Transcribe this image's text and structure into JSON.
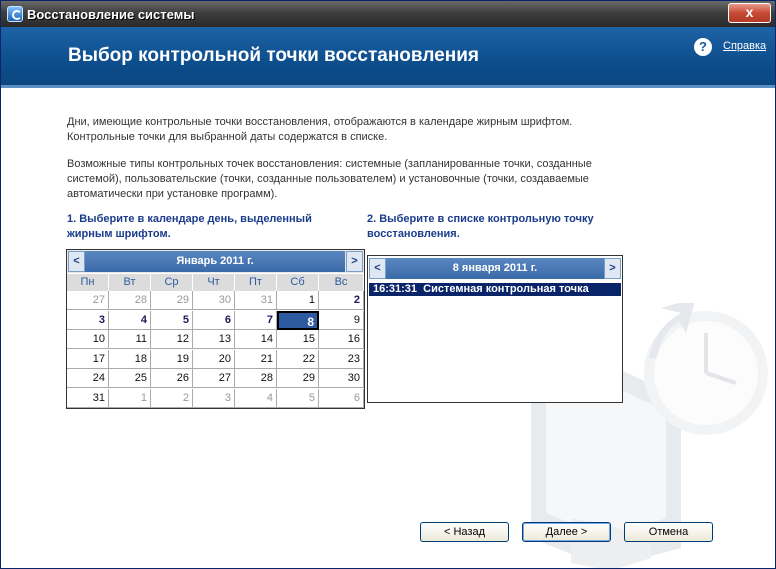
{
  "window": {
    "title": "Восстановление системы",
    "close_label": "x"
  },
  "header": {
    "title": "Выбор контрольной точки восстановления",
    "help_icon": "?",
    "help_label": "Справка"
  },
  "intro": {
    "line1": "Дни, имеющие контрольные точки восстановления, отображаются в календаре жирным шрифтом.",
    "line2": "Контрольные точки для выбранной даты содержатся в списке.",
    "types_line1": "Возможные типы контрольных точек восстановления: системные (запланированные точки, созданные",
    "types_line2": "системой), пользовательские (точки, созданные пользователем) и установочные (точки, создаваемые",
    "types_line3": "автоматически при установке программ)."
  },
  "step1": {
    "line1": "1. Выберите в календаре день, выделенный",
    "line2": "жирным шрифтом."
  },
  "step2": {
    "line1": "2. Выберите в списке контрольную точку",
    "line2": "восстановления."
  },
  "calendar": {
    "prev": "<",
    "next": ">",
    "month": "Январь 2011 г.",
    "weekdays": [
      "Пн",
      "Вт",
      "Ср",
      "Чт",
      "Пт",
      "Сб",
      "Вс"
    ],
    "weeks": [
      [
        {
          "d": "27",
          "t": "other"
        },
        {
          "d": "28",
          "t": "other"
        },
        {
          "d": "29",
          "t": "other"
        },
        {
          "d": "30",
          "t": "other"
        },
        {
          "d": "31",
          "t": "other"
        },
        {
          "d": "1",
          "t": ""
        },
        {
          "d": "2",
          "t": "bold"
        }
      ],
      [
        {
          "d": "3",
          "t": "bold"
        },
        {
          "d": "4",
          "t": "bold"
        },
        {
          "d": "5",
          "t": "bold"
        },
        {
          "d": "6",
          "t": "bold"
        },
        {
          "d": "7",
          "t": "bold"
        },
        {
          "d": "8",
          "t": "sel"
        },
        {
          "d": "9",
          "t": ""
        }
      ],
      [
        {
          "d": "10",
          "t": ""
        },
        {
          "d": "11",
          "t": ""
        },
        {
          "d": "12",
          "t": ""
        },
        {
          "d": "13",
          "t": ""
        },
        {
          "d": "14",
          "t": ""
        },
        {
          "d": "15",
          "t": ""
        },
        {
          "d": "16",
          "t": ""
        }
      ],
      [
        {
          "d": "17",
          "t": ""
        },
        {
          "d": "18",
          "t": ""
        },
        {
          "d": "19",
          "t": ""
        },
        {
          "d": "20",
          "t": ""
        },
        {
          "d": "21",
          "t": ""
        },
        {
          "d": "22",
          "t": ""
        },
        {
          "d": "23",
          "t": ""
        }
      ],
      [
        {
          "d": "24",
          "t": ""
        },
        {
          "d": "25",
          "t": ""
        },
        {
          "d": "26",
          "t": ""
        },
        {
          "d": "27",
          "t": ""
        },
        {
          "d": "28",
          "t": ""
        },
        {
          "d": "29",
          "t": ""
        },
        {
          "d": "30",
          "t": ""
        }
      ],
      [
        {
          "d": "31",
          "t": ""
        },
        {
          "d": "1",
          "t": "other"
        },
        {
          "d": "2",
          "t": "other"
        },
        {
          "d": "3",
          "t": "other"
        },
        {
          "d": "4",
          "t": "other"
        },
        {
          "d": "5",
          "t": "other"
        },
        {
          "d": "6",
          "t": "other"
        }
      ]
    ]
  },
  "restore_list": {
    "prev": "<",
    "next": ">",
    "date": "8 января 2011 г.",
    "items": [
      {
        "time": "16:31:31",
        "description": "Системная контрольная точка"
      }
    ]
  },
  "buttons": {
    "back": "< Назад",
    "next": "Далее >",
    "cancel": "Отмена"
  },
  "colors": {
    "header_bg": "#0d4e8d",
    "accent": "#2d5aa0",
    "selection": "#0a246a",
    "step_text": "#1b3c8c"
  }
}
